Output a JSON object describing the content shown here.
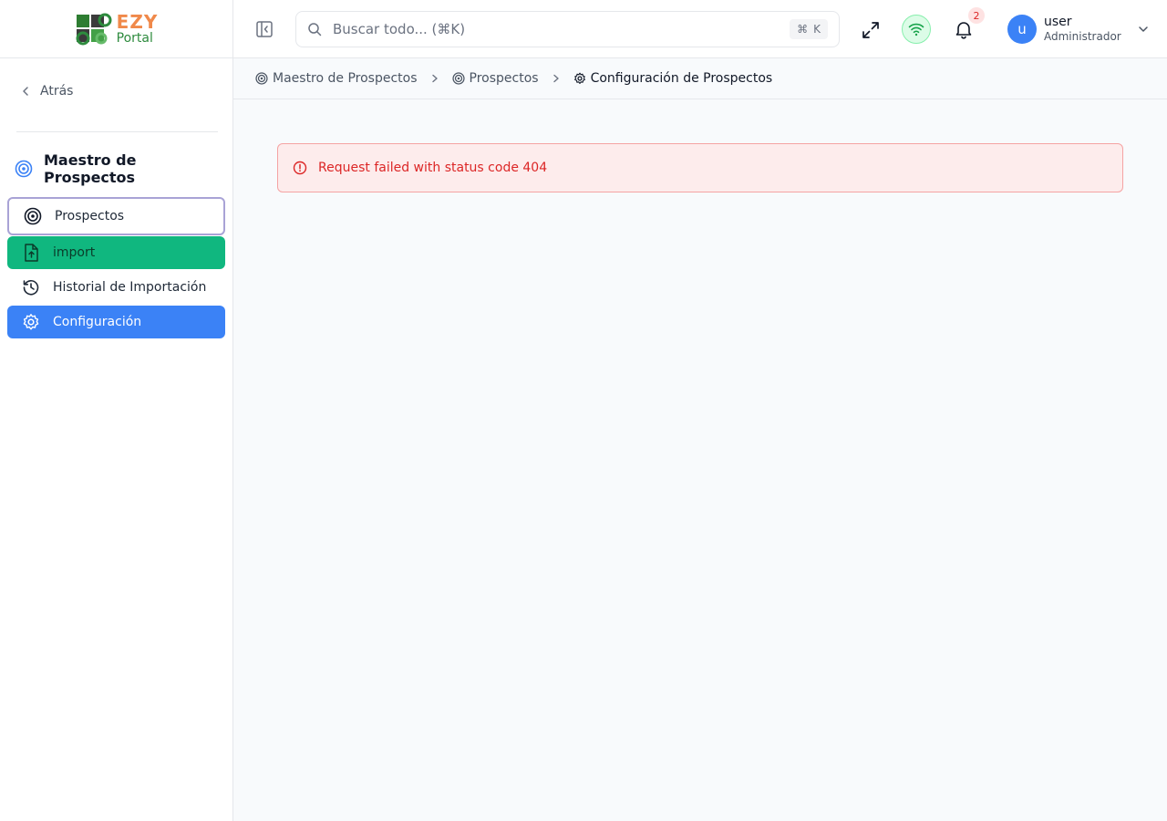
{
  "brand": {
    "logo_line1": "EZY",
    "logo_line2": "Portal",
    "colors": {
      "orange": "#f0894a",
      "green": "#2e8b3e"
    }
  },
  "sidebar": {
    "back_label": "Atrás",
    "module_title": "Maestro de Prospectos",
    "items": [
      {
        "label": "Prospectos",
        "icon": "target-icon",
        "state": "focused"
      },
      {
        "label": "import",
        "icon": "file-upload-icon",
        "state": "highlight-green"
      },
      {
        "label": "Historial de Importación",
        "icon": "history-icon",
        "state": "normal"
      },
      {
        "label": "Configuración",
        "icon": "gear-icon",
        "state": "active"
      }
    ]
  },
  "header": {
    "search_placeholder": "Buscar todo... (⌘K)",
    "shortcut_symbol": "⌘",
    "shortcut_key": "K",
    "notifications_count": "2",
    "user": {
      "initial": "u",
      "name": "user",
      "role": "Administrador"
    }
  },
  "breadcrumb": [
    {
      "label": "Maestro de Prospectos",
      "icon": "target-icon"
    },
    {
      "label": "Prospectos",
      "icon": "target-icon"
    },
    {
      "label": "Configuración de Prospectos",
      "icon": "gear-icon"
    }
  ],
  "alert": {
    "message": "Request failed with status code 404",
    "color": "#dc2626"
  },
  "accent": {
    "blue": "#3b82f6",
    "green": "#10b77f"
  }
}
